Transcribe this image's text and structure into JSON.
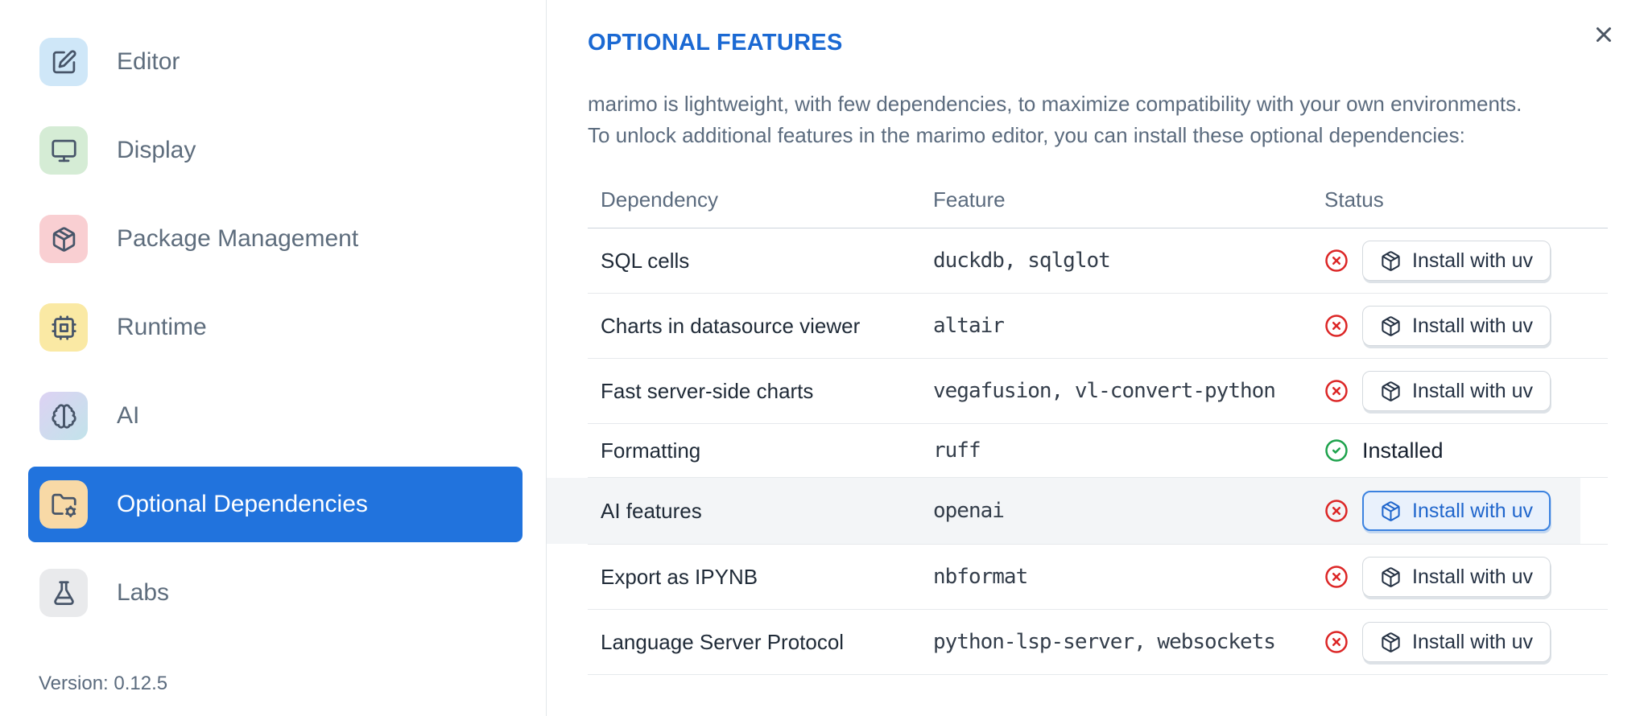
{
  "sidebar": {
    "items": [
      {
        "label": "Editor",
        "icon": "square-pen-icon",
        "tile_bg": "#cfe7f8"
      },
      {
        "label": "Display",
        "icon": "monitor-icon",
        "tile_bg": "#d5ecd5"
      },
      {
        "label": "Package Management",
        "icon": "package-icon",
        "tile_bg": "#f9cfd2"
      },
      {
        "label": "Runtime",
        "icon": "cpu-icon",
        "tile_bg": "#fae9a4"
      },
      {
        "label": "AI",
        "icon": "brain-icon",
        "tile_bg": "linear-gradient(135deg,#ddd2f3 0%,#c2e3ea 100%)"
      },
      {
        "label": "Optional Dependencies",
        "icon": "folder-cog-icon",
        "tile_bg": "#f8d9a6",
        "selected": true
      },
      {
        "label": "Labs",
        "icon": "flask-icon",
        "tile_bg": "#e9eaec"
      }
    ],
    "version_label": "Version: 0.12.5",
    "selected_color": "#2173dd"
  },
  "panel": {
    "title": "OPTIONAL FEATURES",
    "title_color": "#1b69d3",
    "description": "marimo is lightweight, with few dependencies, to maximize compatibility with your own environments. To unlock additional features in the marimo editor, you can install these optional dependencies:",
    "close_icon": "x-icon"
  },
  "table": {
    "columns": [
      "Dependency",
      "Feature",
      "Status"
    ],
    "install_button_label": "Install with uv",
    "install_button_icon": "package-icon",
    "installed_label": "Installed",
    "rows": [
      {
        "dependency": "SQL cells",
        "feature": "duckdb, sqlglot",
        "status": "missing"
      },
      {
        "dependency": "Charts in datasource viewer",
        "feature": "altair",
        "status": "missing"
      },
      {
        "dependency": "Fast server-side charts",
        "feature": "vegafusion, vl-convert-python",
        "status": "missing"
      },
      {
        "dependency": "Formatting",
        "feature": "ruff",
        "status": "installed"
      },
      {
        "dependency": "AI features",
        "feature": "openai",
        "status": "missing",
        "highlighted": true
      },
      {
        "dependency": "Export as IPYNB",
        "feature": "nbformat",
        "status": "missing"
      },
      {
        "dependency": "Language Server Protocol",
        "feature": "python-lsp-server, websockets",
        "status": "missing"
      }
    ]
  },
  "colors": {
    "status_missing": "#dc2626",
    "status_installed": "#1da24c",
    "accent_blue": "#2173dd"
  }
}
